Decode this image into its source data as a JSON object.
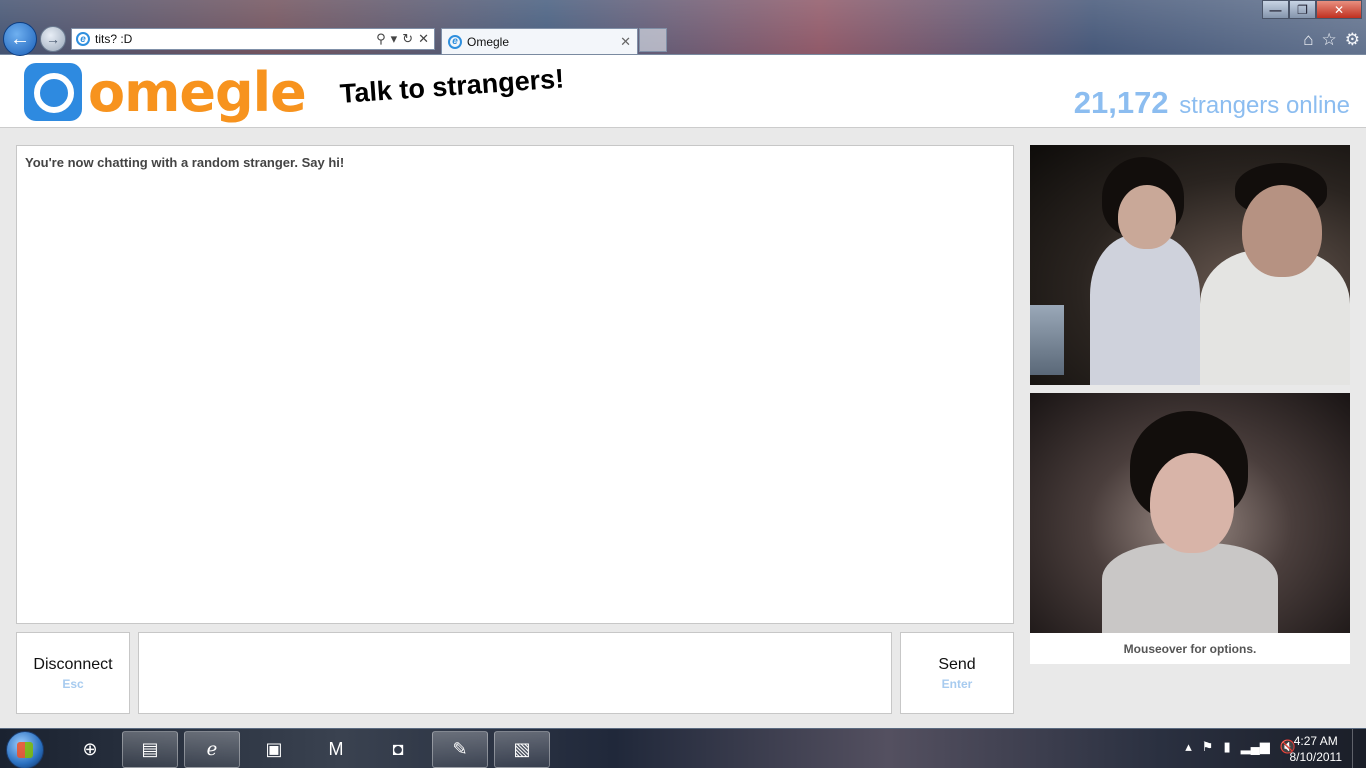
{
  "browser": {
    "address": "tits? :D",
    "tab_title": "Omegle",
    "window_controls": {
      "minimize": "—",
      "maximize": "❐",
      "close": "✕"
    }
  },
  "header": {
    "logo_text": "omegle",
    "tagline": "Talk to strangers!",
    "online_count": "21,172",
    "online_label": "strangers online"
  },
  "chat": {
    "status_message": "You're now chatting with a random stranger. Say hi!",
    "message_input_value": ""
  },
  "controls": {
    "disconnect_label": "Disconnect",
    "disconnect_key": "Esc",
    "send_label": "Send",
    "send_key": "Enter"
  },
  "video": {
    "caption": "Mouseover for options."
  },
  "colors": {
    "brand_orange": "#f7931e",
    "brand_blue": "#2e8ae0",
    "online_blue": "#8cbdf0",
    "hint_blue": "#a7cbef"
  },
  "taskbar": {
    "items": [
      "file-explorer",
      "internet-explorer",
      "blackboard",
      "mail-m",
      "outlook",
      "paint",
      "photo-viewer"
    ],
    "clock_time": "4:27 AM",
    "clock_date": "8/10/2011"
  }
}
